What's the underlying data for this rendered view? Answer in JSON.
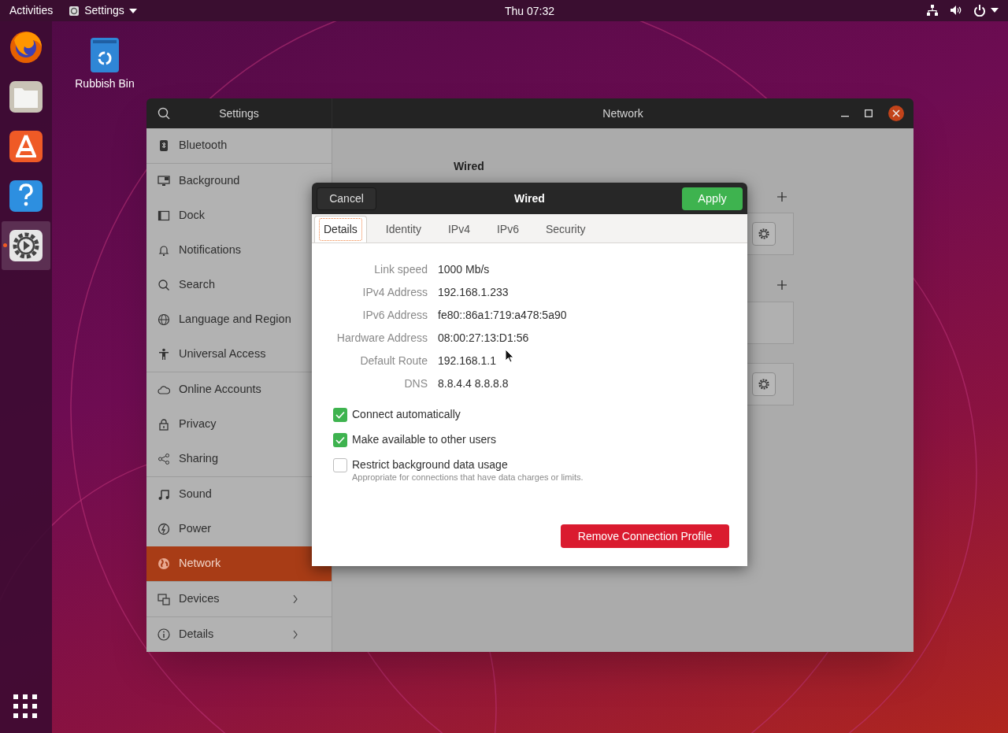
{
  "top_bar": {
    "activities": "Activities",
    "app_menu": "Settings",
    "clock": "Thu 07:32"
  },
  "dock": {
    "items": [
      {
        "running": false
      },
      {
        "running": false
      },
      {
        "running": false
      },
      {
        "running": false
      },
      {
        "running": true
      }
    ]
  },
  "desktop_icons": [
    {
      "label": "Rubbish Bin"
    }
  ],
  "settings_window": {
    "title": "Settings",
    "panel_title": "Network",
    "sidebar": {
      "groups": [
        [
          {
            "label": "Bluetooth",
            "selected": false,
            "submenu": false
          }
        ],
        [
          {
            "label": "Background",
            "selected": false,
            "submenu": false
          },
          {
            "label": "Dock",
            "selected": false,
            "submenu": false
          },
          {
            "label": "Notifications",
            "selected": false,
            "submenu": false
          },
          {
            "label": "Search",
            "selected": false,
            "submenu": false
          },
          {
            "label": "Language and Region",
            "selected": false,
            "submenu": false
          },
          {
            "label": "Universal Access",
            "selected": false,
            "submenu": false
          }
        ],
        [
          {
            "label": "Online Accounts",
            "selected": false,
            "submenu": false
          },
          {
            "label": "Privacy",
            "selected": false,
            "submenu": false
          },
          {
            "label": "Sharing",
            "selected": false,
            "submenu": false
          }
        ],
        [
          {
            "label": "Sound",
            "selected": false,
            "submenu": false
          },
          {
            "label": "Power",
            "selected": false,
            "submenu": false
          },
          {
            "label": "Network",
            "selected": true,
            "submenu": false
          }
        ],
        [
          {
            "label": "Devices",
            "selected": false,
            "submenu": true
          }
        ],
        [
          {
            "label": "Details",
            "selected": false,
            "submenu": true
          }
        ]
      ]
    },
    "network_panel": {
      "section_title": "Wired"
    }
  },
  "dialog": {
    "title": "Wired",
    "cancel": "Cancel",
    "apply": "Apply",
    "tabs": [
      {
        "label": "Details",
        "selected": true
      },
      {
        "label": "Identity",
        "selected": false
      },
      {
        "label": "IPv4",
        "selected": false
      },
      {
        "label": "IPv6",
        "selected": false
      },
      {
        "label": "Security",
        "selected": false
      }
    ],
    "details": [
      {
        "label": "Link speed",
        "value": "1000 Mb/s"
      },
      {
        "label": "IPv4 Address",
        "value": "192.168.1.233"
      },
      {
        "label": "IPv6 Address",
        "value": "fe80::86a1:719:a478:5a90"
      },
      {
        "label": "Hardware Address",
        "value": "08:00:27:13:D1:56"
      },
      {
        "label": "Default Route",
        "value": "192.168.1.1"
      },
      {
        "label": "DNS",
        "value": "8.8.4.4 8.8.8.8"
      }
    ],
    "options": [
      {
        "label": "Connect automatically",
        "checked": true
      },
      {
        "label": "Make available to other users",
        "checked": true
      },
      {
        "label": "Restrict background data usage",
        "checked": false,
        "hint": "Appropriate for connections that have data charges or limits."
      }
    ],
    "remove_button": "Remove Connection Profile"
  }
}
